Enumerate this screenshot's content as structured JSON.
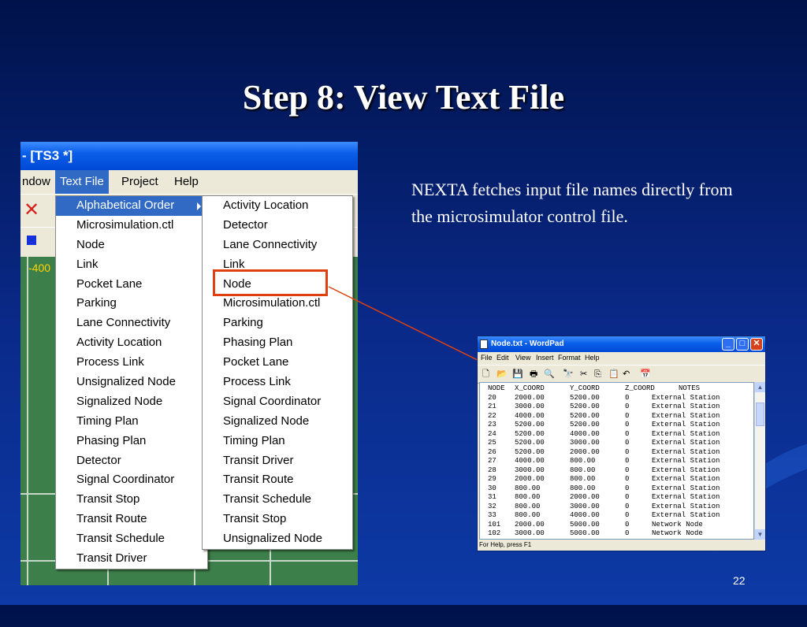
{
  "slide": {
    "title": "Step 8: View Text File",
    "body": "NEXTA fetches input file names directly from the microsimulator control file.",
    "page_number": "22"
  },
  "nexta": {
    "window_title": "- [TS3 *]",
    "menubar": [
      "ndow",
      "Text File",
      "Project",
      "Help"
    ],
    "active_menu": "Text File",
    "map_coord_label": "-400",
    "menu_primary": [
      "Alphabetical Order",
      "Microsimulation.ctl",
      "Node",
      "Link",
      "Pocket Lane",
      "Parking",
      "Lane Connectivity",
      "Activity Location",
      "Process Link",
      "Unsignalized Node",
      "Signalized Node",
      "Timing Plan",
      "Phasing Plan",
      "Detector",
      "Signal Coordinator",
      "Transit Stop",
      "Transit Route",
      "Transit Schedule",
      "Transit Driver"
    ],
    "menu_alphabetical": [
      "Activity Location",
      "Detector",
      "Lane Connectivity",
      "Link",
      "Node",
      "Microsimulation.ctl",
      "Parking",
      "Phasing Plan",
      "Pocket Lane",
      "Process Link",
      "Signal Coordinator",
      "Signalized Node",
      "Timing Plan",
      "Transit Driver",
      "Transit Route",
      "Transit Schedule",
      "Transit Stop",
      "Unsignalized Node"
    ],
    "highlighted_item": "Node"
  },
  "wordpad": {
    "title": "Node.txt - WordPad",
    "menubar": [
      "File",
      "Edit",
      "View",
      "Insert",
      "Format",
      "Help"
    ],
    "header": [
      "NODE",
      "X_COORD",
      "Y_COORD",
      "Z_COORD",
      "NOTES"
    ],
    "rows": [
      [
        "20",
        "2000.00",
        "5200.00",
        "0",
        "External Station"
      ],
      [
        "21",
        "3000.00",
        "5200.00",
        "0",
        "External Station"
      ],
      [
        "22",
        "4000.00",
        "5200.00",
        "0",
        "External Station"
      ],
      [
        "23",
        "5200.00",
        "5200.00",
        "0",
        "External Station"
      ],
      [
        "24",
        "5200.00",
        "4000.00",
        "0",
        "External Station"
      ],
      [
        "25",
        "5200.00",
        "3000.00",
        "0",
        "External Station"
      ],
      [
        "26",
        "5200.00",
        "2000.00",
        "0",
        "External Station"
      ],
      [
        "27",
        "4000.00",
        "800.00",
        "0",
        "External Station"
      ],
      [
        "28",
        "3000.00",
        "800.00",
        "0",
        "External Station"
      ],
      [
        "29",
        "2000.00",
        "800.00",
        "0",
        "External Station"
      ],
      [
        "30",
        "800.00",
        "800.00",
        "0",
        "External Station"
      ],
      [
        "31",
        "800.00",
        "2000.00",
        "0",
        "External Station"
      ],
      [
        "32",
        "800.00",
        "3000.00",
        "0",
        "External Station"
      ],
      [
        "33",
        "800.00",
        "4000.00",
        "0",
        "External Station"
      ],
      [
        "101",
        "2000.00",
        "5000.00",
        "0",
        "Network Node"
      ],
      [
        "102",
        "3000.00",
        "5000.00",
        "0",
        "Network Node"
      ]
    ],
    "status": "For Help, press F1"
  },
  "colors": {
    "background": "#0a2a8a",
    "menu_highlight": "#316ac5",
    "callout": "#e04010",
    "map": "#3d7f4a"
  }
}
